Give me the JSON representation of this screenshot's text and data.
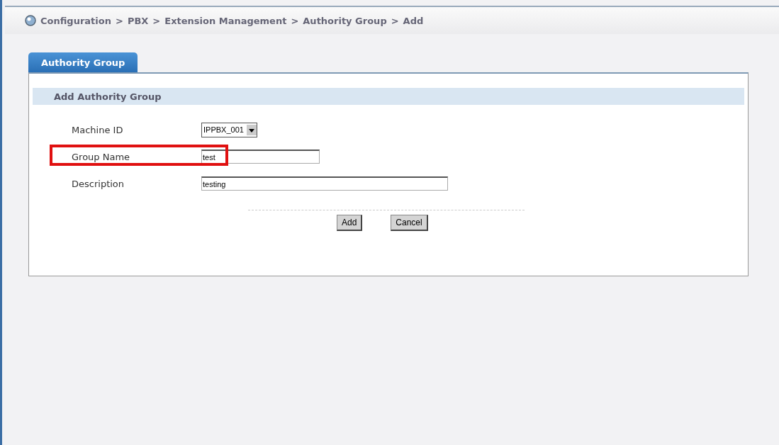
{
  "breadcrumb": [
    "Configuration",
    "PBX",
    "Extension Management",
    "Authority Group",
    "Add"
  ],
  "breadcrumb_separator": ">",
  "tabs": [
    {
      "label": "Authority Group",
      "selected": true
    }
  ],
  "section_title": "Add Authority Group",
  "fields": [
    {
      "kind": "select",
      "label": "Machine ID",
      "value": "IPPBX_001",
      "highlighted": false
    },
    {
      "kind": "text",
      "label": "Group Name",
      "value": "test",
      "highlighted": true
    },
    {
      "kind": "wide",
      "label": "Description",
      "value": "testing",
      "highlighted": false
    }
  ],
  "buttons": [
    "Add",
    "Cancel"
  ]
}
